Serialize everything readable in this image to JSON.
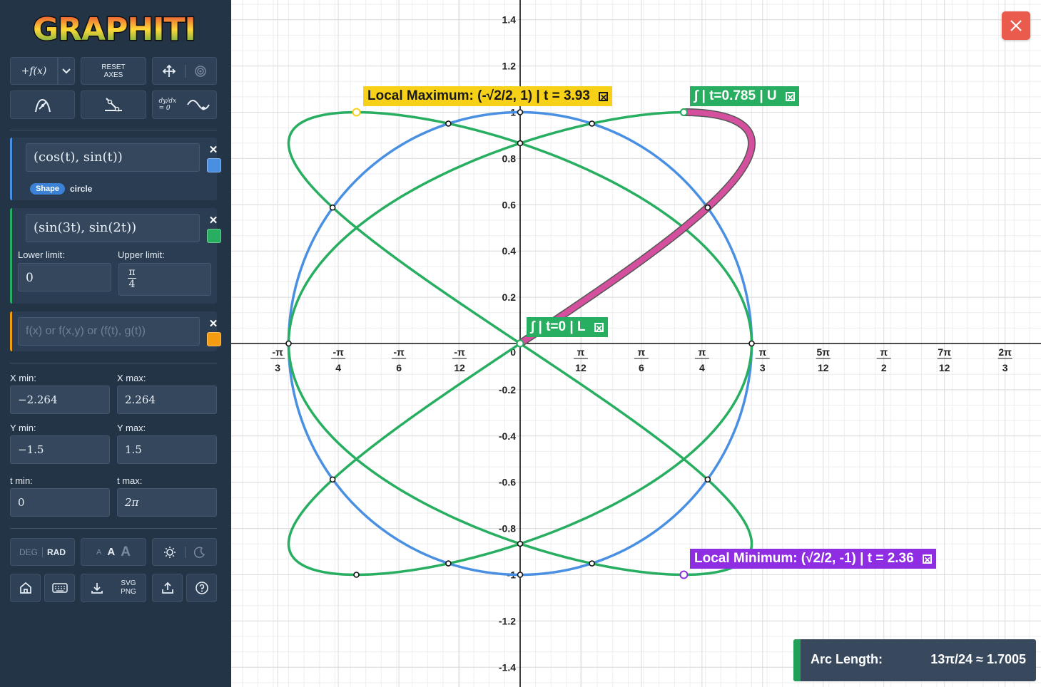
{
  "app": {
    "logo_text": "GRAPHITI"
  },
  "toolbar": {
    "add_function_label": "+f(x)",
    "reset_axes_label_1": "RESET",
    "reset_axes_label_2": "AXES",
    "move_icon": "move-arrows-icon",
    "target_icon": "target-icon",
    "curve_tool_icon": "curve-draw-icon",
    "tangent_tool_icon": "tangent-line-icon",
    "diff_eq_label": "dy/dx = 0",
    "wave_icon": "wave-curve-icon"
  },
  "expressions": [
    {
      "value": "(cos(t), sin(t))",
      "color": "#4a90e2",
      "shape_badge": "Shape",
      "shape_name": "circle"
    },
    {
      "value": "(sin(3t), sin(2t))",
      "color": "#27ae60",
      "lower_label": "Lower limit:",
      "lower_value": "0",
      "upper_label": "Upper limit:",
      "upper_value_num": "π",
      "upper_value_den": "4"
    },
    {
      "placeholder": "f(x) or f(x,y) or (f(t), g(t))",
      "color": "#f39c12"
    }
  ],
  "ranges": {
    "xmin_label": "X min:",
    "xmin": "−2.264",
    "xmax_label": "X max:",
    "xmax": "2.264",
    "ymin_label": "Y min:",
    "ymin": "−1.5",
    "ymax_label": "Y max:",
    "ymax": "1.5",
    "tmin_label": "t min:",
    "tmin": "0",
    "tmax_label": "t max:",
    "tmax": "2π"
  },
  "bottom_toolbar": {
    "deg": "DEG",
    "rad": "RAD",
    "font_small": "A",
    "font_med": "A",
    "font_large": "A",
    "svg_label": "SVG",
    "png_label": "PNG"
  },
  "graph": {
    "x_ticks": [
      {
        "num": "-π",
        "den": "3"
      },
      {
        "num": "-π",
        "den": "4"
      },
      {
        "num": "-π",
        "den": "6"
      },
      {
        "num": "-π",
        "den": "12"
      },
      {
        "num": "π",
        "den": "12"
      },
      {
        "num": "π",
        "den": "6"
      },
      {
        "num": "π",
        "den": "4"
      },
      {
        "num": "π",
        "den": "3"
      },
      {
        "num": "5π",
        "den": "12"
      },
      {
        "num": "π",
        "den": "2"
      },
      {
        "num": "7π",
        "den": "12"
      },
      {
        "num": "2π",
        "den": "3"
      }
    ],
    "origin_label": "0",
    "y_ticks": [
      "1.4",
      "1.2",
      "1",
      "0.8",
      "0.6",
      "0.4",
      "0.2",
      "-0.2",
      "-0.4",
      "-0.6",
      "-0.8",
      "-1",
      "-1.2",
      "-1.4"
    ]
  },
  "annotations": {
    "local_max": {
      "text": "Local Maximum: (-√2/2, 1) | t = 3.93",
      "color": "#f7d117"
    },
    "integral_upper": {
      "text": "∫ | t=0.785 | U",
      "color": "#27ae60"
    },
    "integral_lower": {
      "text": "∫ | t=0 | L",
      "color": "#27ae60"
    },
    "local_min": {
      "text": "Local Minimum: (√2/2, -1) | t = 2.36",
      "color": "#8e2de2"
    }
  },
  "arc_length": {
    "label": "Arc Length:",
    "value": "13π/24 ≈ 1.7005"
  },
  "close_icon": "close-x-icon"
}
